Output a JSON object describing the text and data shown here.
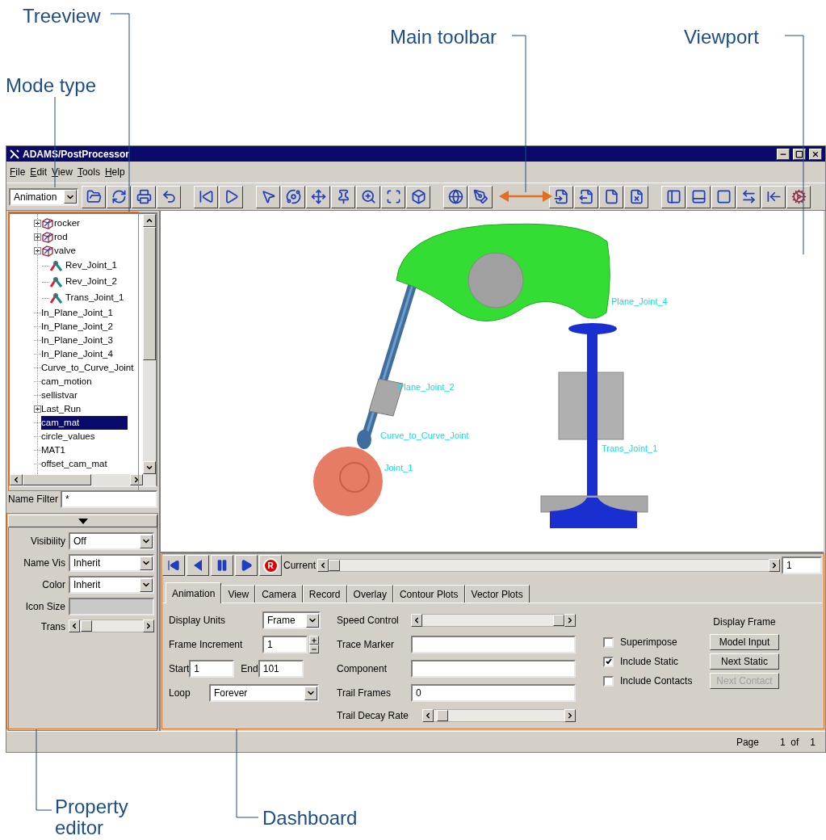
{
  "annotations": [
    {
      "text": "Treeview"
    },
    {
      "text": "Mode type"
    },
    {
      "text": "Main toolbar"
    },
    {
      "text": "Viewport"
    },
    {
      "text": "Property editor"
    },
    {
      "text": "Dashboard"
    }
  ],
  "window": {
    "title": "ADAMS/PostProcessor"
  },
  "menu": [
    "File",
    "Edit",
    "View",
    "Tools",
    "Help"
  ],
  "mode_select": {
    "value": "Animation"
  },
  "tree": {
    "items": [
      {
        "label": "rocker",
        "kind": "part",
        "expanded": false,
        "selected": false
      },
      {
        "label": "rod",
        "kind": "part",
        "expanded": false,
        "selected": false
      },
      {
        "label": "valve",
        "kind": "part",
        "expanded": false,
        "selected": false
      },
      {
        "label": "Rev_Joint_1",
        "kind": "joint",
        "selected": false
      },
      {
        "label": "Rev_Joint_2",
        "kind": "joint",
        "selected": false
      },
      {
        "label": "Trans_Joint_1",
        "kind": "joint",
        "selected": false
      },
      {
        "label": "In_Plane_Joint_1",
        "kind": "item",
        "selected": false
      },
      {
        "label": "In_Plane_Joint_2",
        "kind": "item",
        "selected": false
      },
      {
        "label": "In_Plane_Joint_3",
        "kind": "item",
        "selected": false
      },
      {
        "label": "In_Plane_Joint_4",
        "kind": "item",
        "selected": false
      },
      {
        "label": "Curve_to_Curve_Joint",
        "kind": "item",
        "selected": false
      },
      {
        "label": "cam_motion",
        "kind": "item",
        "selected": false
      },
      {
        "label": "sellistvar",
        "kind": "item",
        "selected": false
      },
      {
        "label": "Last_Run",
        "kind": "group",
        "expanded": false,
        "selected": false
      },
      {
        "label": "cam_mat",
        "kind": "item",
        "selected": true
      },
      {
        "label": "circle_values",
        "kind": "item",
        "selected": false
      },
      {
        "label": "MAT1",
        "kind": "item",
        "selected": false
      },
      {
        "label": "offset_cam_mat",
        "kind": "item",
        "selected": false
      }
    ]
  },
  "name_filter": {
    "label": "Name Filter",
    "value": "*"
  },
  "property_editor": {
    "fields": [
      {
        "kind": "select",
        "label": "Visibility",
        "value": "Off"
      },
      {
        "kind": "select",
        "label": "Name Vis",
        "value": "Inherit"
      },
      {
        "kind": "select",
        "label": "Color",
        "value": "Inherit"
      },
      {
        "kind": "field",
        "label": "Icon Size",
        "disabled": true
      },
      {
        "kind": "slider",
        "label": "Trans",
        "level": 0.02
      }
    ]
  },
  "viewport": {
    "labels": [
      {
        "text": "Plane_Joint_4"
      },
      {
        "text": "Plane_Joint_2"
      },
      {
        "text": "Curve_to_Curve_Joint"
      },
      {
        "text": "Joint_1"
      },
      {
        "text": "Trans_Joint_1"
      }
    ]
  },
  "dashboard": {
    "record_glyph": "R",
    "current": {
      "label": "Current",
      "level": 0,
      "value": "1"
    },
    "tabs": [
      {
        "label": "Animation",
        "selected": true
      },
      {
        "label": "View",
        "selected": false
      },
      {
        "label": "Camera",
        "selected": false
      },
      {
        "label": "Record",
        "selected": false
      },
      {
        "label": "Overlay",
        "selected": false
      },
      {
        "label": "Contour Plots",
        "selected": false
      },
      {
        "label": "Vector Plots",
        "selected": false
      }
    ],
    "display_units": {
      "label": "Display Units",
      "value": "Frame"
    },
    "frame_increment": {
      "label": "Frame Increment",
      "value": "1"
    },
    "start": {
      "label": "Start",
      "value": "1"
    },
    "end": {
      "label": "End",
      "value": "101"
    },
    "loop": {
      "label": "Loop",
      "value": "Forever"
    },
    "speed_control": {
      "label": "Speed Control",
      "level": 1
    },
    "trace_marker": {
      "label": "Trace Marker"
    },
    "component": {
      "label": "Component"
    },
    "trail_frames": {
      "label": "Trail Frames",
      "value": "0"
    },
    "trail_decay_rate": {
      "label": "Trail Decay Rate",
      "level": 0.03
    },
    "checkboxes": [
      {
        "label": "Superimpose",
        "checked": false
      },
      {
        "label": "Include Static",
        "checked": true
      },
      {
        "label": "Include Contacts",
        "checked": false
      }
    ],
    "display_frame": {
      "title": "Display Frame",
      "buttons": [
        {
          "label": "Model Input",
          "disabled": false
        },
        {
          "label": "Next Static",
          "disabled": false
        },
        {
          "label": "Next Contact",
          "disabled": true
        }
      ]
    }
  },
  "status_bar": {
    "label": "Page",
    "page": "1  of",
    "total": "1"
  }
}
